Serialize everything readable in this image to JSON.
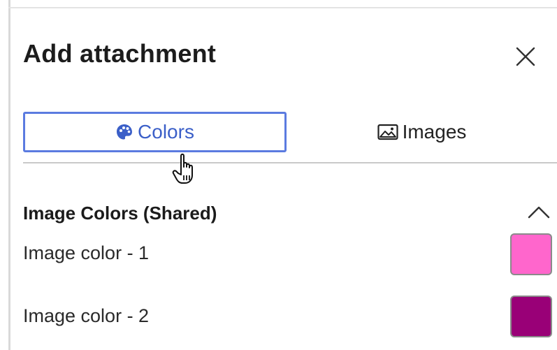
{
  "dialog": {
    "title": "Add attachment",
    "close_icon": "close-icon"
  },
  "tabs": [
    {
      "label": "Colors",
      "icon": "palette-icon",
      "selected": true
    },
    {
      "label": "Images",
      "icon": "image-icon",
      "selected": false
    }
  ],
  "section": {
    "title": "Image Colors (Shared)",
    "toggle_icon": "chevron-up-icon",
    "expanded": true
  },
  "colors": [
    {
      "label": "Image color - 1",
      "value": "#ff66cc"
    },
    {
      "label": "Image color - 2",
      "value": "#990077"
    }
  ],
  "accent": "#4a6fd8"
}
